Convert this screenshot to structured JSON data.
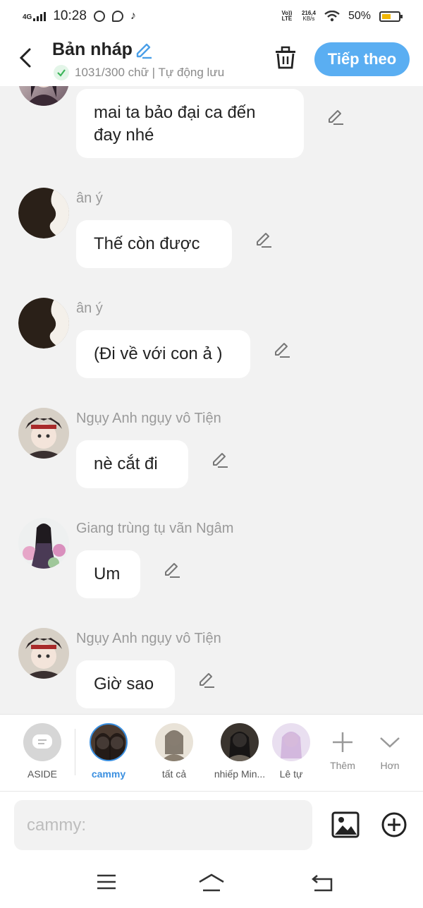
{
  "status_bar": {
    "network": "4G",
    "time": "10:28",
    "lte_label": "Vo)) LTE",
    "speed": "216,4",
    "speed_unit": "KB/s",
    "battery": "50%"
  },
  "header": {
    "title": "Bản nháp",
    "status": "1031/300 chữ | Tự động lưu",
    "next_label": "Tiếp theo"
  },
  "messages": [
    {
      "avatar": "girl-anime-avatar",
      "name": "",
      "text_lines": [
        "mai ta bảo đại ca đến",
        "đay nhé"
      ]
    },
    {
      "avatar": "silhouette-avatar",
      "name": "ân ý",
      "text_lines": [
        "Thế còn được"
      ]
    },
    {
      "avatar": "silhouette-avatar",
      "name": "ân ý",
      "text_lines": [
        "(Đi về với con ả )"
      ]
    },
    {
      "avatar": "nguy-anh-avatar",
      "name": "Ngụy Anh ngụy vô Tiện",
      "text_lines": [
        "nè cắt đi"
      ]
    },
    {
      "avatar": "giang-avatar",
      "name": "Giang trùng tụ vãn Ngâm",
      "text_lines": [
        "Um"
      ]
    },
    {
      "avatar": "nguy-anh-avatar",
      "name": "Ngụy Anh ngụy vô Tiện",
      "text_lines": [
        "Giờ sao"
      ]
    }
  ],
  "characters": [
    {
      "label": "ASIDE",
      "active": false
    },
    {
      "label": "cammy",
      "active": true
    },
    {
      "label": "tất cả",
      "active": false
    },
    {
      "label": "nhiếp Min...",
      "active": false
    },
    {
      "label": "Lê tự",
      "active": false
    }
  ],
  "more_label": "Thêm",
  "expand_label": "Hơn",
  "input": {
    "placeholder": "cammy:"
  }
}
